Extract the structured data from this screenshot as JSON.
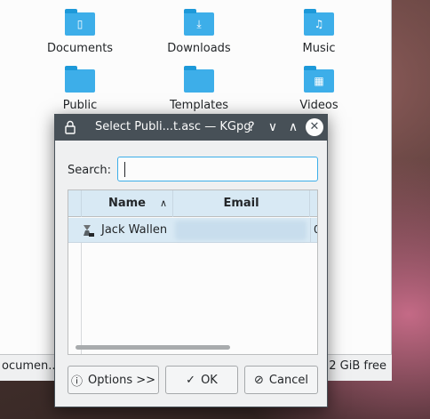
{
  "file_manager": {
    "items": [
      {
        "label": "Documents",
        "icon": "documents-folder-icon",
        "glyph": "▯"
      },
      {
        "label": "Downloads",
        "icon": "downloads-folder-icon",
        "glyph": "⤓"
      },
      {
        "label": "Music",
        "icon": "music-folder-icon",
        "glyph": "♫"
      },
      {
        "label": "Public",
        "icon": "public-folder-icon",
        "glyph": ""
      },
      {
        "label": "Templates",
        "icon": "templates-folder-icon",
        "glyph": ""
      },
      {
        "label": "Videos",
        "icon": "videos-folder-icon",
        "glyph": "▦"
      }
    ],
    "status_left": "ocumen...",
    "status_right": ".2 GiB free"
  },
  "dialog": {
    "title": "Select Publi...t.asc — KGpg",
    "titlebar_buttons": {
      "help": "?",
      "minimize": "∨",
      "maximize": "∧",
      "close": "✕"
    },
    "search_label": "Search:",
    "search_value": "",
    "columns": {
      "name": "Name",
      "email": "Email"
    },
    "rows": [
      {
        "name": "Jack Wallen",
        "email": "",
        "truncated": "0"
      }
    ],
    "buttons": {
      "options": "Options >>",
      "ok": "OK",
      "cancel": "Cancel"
    }
  },
  "colors": {
    "accent": "#3daee9",
    "titlebar": "#475057",
    "selection": "#d8e9f4"
  }
}
